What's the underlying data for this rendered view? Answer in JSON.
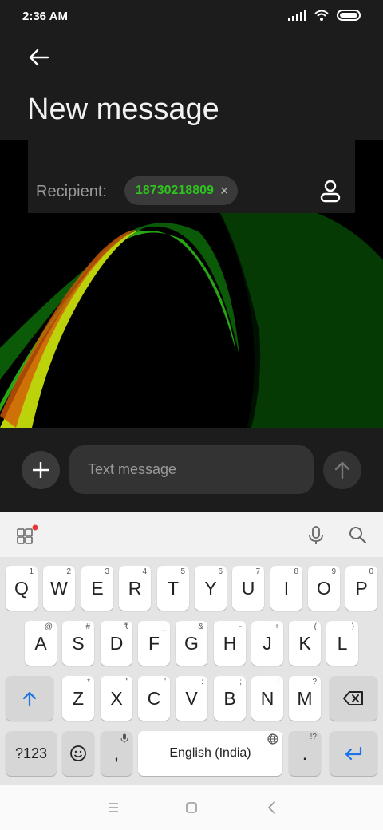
{
  "status_bar": {
    "time": "2:36 AM"
  },
  "header": {
    "title": "New message"
  },
  "recipient": {
    "label": "Recipient:",
    "chip_number": "18730218809",
    "chip_remove": "×"
  },
  "compose": {
    "placeholder": "Text message"
  },
  "keyboard": {
    "row1": [
      {
        "label": "Q",
        "hint": "1"
      },
      {
        "label": "W",
        "hint": "2"
      },
      {
        "label": "E",
        "hint": "3"
      },
      {
        "label": "R",
        "hint": "4"
      },
      {
        "label": "T",
        "hint": "5"
      },
      {
        "label": "Y",
        "hint": "6"
      },
      {
        "label": "U",
        "hint": "7"
      },
      {
        "label": "I",
        "hint": "8"
      },
      {
        "label": "O",
        "hint": "9"
      },
      {
        "label": "P",
        "hint": "0"
      }
    ],
    "row2": [
      {
        "label": "A",
        "hint": "@"
      },
      {
        "label": "S",
        "hint": "#"
      },
      {
        "label": "D",
        "hint": "₹"
      },
      {
        "label": "F",
        "hint": "_"
      },
      {
        "label": "G",
        "hint": "&"
      },
      {
        "label": "H",
        "hint": "-"
      },
      {
        "label": "J",
        "hint": "+"
      },
      {
        "label": "K",
        "hint": "("
      },
      {
        "label": "L",
        "hint": ")"
      }
    ],
    "row3": [
      {
        "label": "Z",
        "hint": "*"
      },
      {
        "label": "X",
        "hint": "\""
      },
      {
        "label": "C",
        "hint": "'"
      },
      {
        "label": "V",
        "hint": ":"
      },
      {
        "label": "B",
        "hint": ";"
      },
      {
        "label": "N",
        "hint": "!"
      },
      {
        "label": "M",
        "hint": "?"
      }
    ],
    "symbols_key": "?123",
    "comma_key": ",",
    "space_key": "English (India)",
    "period_key": ".",
    "period_hint": "!?"
  },
  "colors": {
    "accent_green": "#2ec31e",
    "dark_panel": "#1c1c1c",
    "enter_blue": "#1a73e8",
    "notification_dot": "#e53935"
  },
  "icons": [
    "back-arrow-icon",
    "contact-icon",
    "plus-icon",
    "send-arrow-icon",
    "apps-grid-icon",
    "microphone-icon",
    "search-icon",
    "shift-icon",
    "backspace-icon",
    "emoji-icon",
    "globe-icon",
    "enter-icon",
    "recents-icon",
    "home-icon",
    "nav-back-icon"
  ]
}
